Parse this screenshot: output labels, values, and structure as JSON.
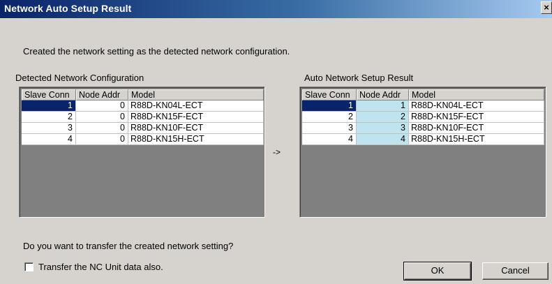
{
  "window": {
    "title": "Network Auto Setup Result",
    "close_label": "×"
  },
  "message": "Created the network setting as the detected network configuration.",
  "detected": {
    "label": "Detected Network Configuration",
    "columns": [
      "Slave Conn",
      "Node Addr",
      "Model"
    ],
    "rows": [
      {
        "slave": "1",
        "node": "0",
        "model": "R88D-KN04L-ECT"
      },
      {
        "slave": "2",
        "node": "0",
        "model": "R88D-KN15F-ECT"
      },
      {
        "slave": "3",
        "node": "0",
        "model": "R88D-KN10F-ECT"
      },
      {
        "slave": "4",
        "node": "0",
        "model": "R88D-KN15H-ECT"
      }
    ]
  },
  "arrow": "->",
  "result": {
    "label": "Auto Network Setup Result",
    "columns": [
      "Slave Conn",
      "Node Addr",
      "Model"
    ],
    "rows": [
      {
        "slave": "1",
        "node": "1",
        "model": "R88D-KN04L-ECT"
      },
      {
        "slave": "2",
        "node": "2",
        "model": "R88D-KN15F-ECT"
      },
      {
        "slave": "3",
        "node": "3",
        "model": "R88D-KN10F-ECT"
      },
      {
        "slave": "4",
        "node": "4",
        "model": "R88D-KN15H-ECT"
      }
    ]
  },
  "question": "Do you want to transfer the created network setting?",
  "checkbox": {
    "label": "Transfer the NC Unit data also.",
    "checked": false
  },
  "buttons": {
    "ok": "OK",
    "cancel": "Cancel"
  },
  "colors": {
    "selection": "#0a246a",
    "node_highlight": "#bfe4ee",
    "titlebar": "#0a246a"
  }
}
